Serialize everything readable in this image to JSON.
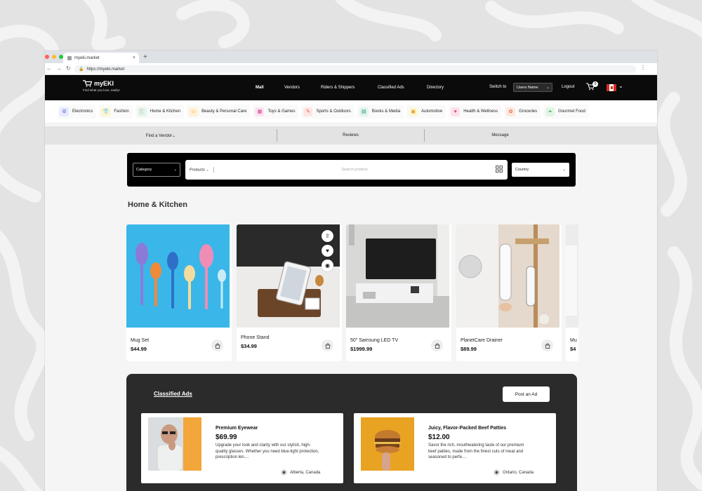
{
  "browser": {
    "tab_title": "myeki.market",
    "tab_close": "×",
    "new_tab": "+",
    "url": "https://myeki.market",
    "back": "←",
    "forward": "→",
    "reload": "↻",
    "menu": "⋮",
    "lock": "🔒"
  },
  "header": {
    "brand": "myEKI",
    "tagline": "Find what you love, easily!",
    "nav": [
      {
        "label": "Mall"
      },
      {
        "label": "Vendors"
      },
      {
        "label": "Riders & Shippers"
      },
      {
        "label": "Classified Ads"
      },
      {
        "label": "Directory"
      }
    ],
    "switch_to": "Switch to",
    "users_select": "Users Name",
    "logout": "Logout",
    "cart_count": "0",
    "caret": "⌄"
  },
  "categories": [
    {
      "label": "Electronics",
      "icon": "⚙",
      "bg": "#e6e9ff",
      "fg": "#5b5fd6"
    },
    {
      "label": "Fashion",
      "icon": "👕",
      "bg": "#fff4cc",
      "fg": "#d19a00"
    },
    {
      "label": "Home & Kitchen",
      "icon": "🍴",
      "bg": "#e3f5e9",
      "fg": "#2e9c57"
    },
    {
      "label": "Beauty & Personal Care",
      "icon": "☺",
      "bg": "#fff1d6",
      "fg": "#e09a1a"
    },
    {
      "label": "Toys & Games",
      "icon": "▦",
      "bg": "#fde3ef",
      "fg": "#d63b86"
    },
    {
      "label": "Sports & Outdoors",
      "icon": "✎",
      "bg": "#ffe5e1",
      "fg": "#e35a3f"
    },
    {
      "label": "Books & Media",
      "icon": "▤",
      "bg": "#e0f4ec",
      "fg": "#24966a"
    },
    {
      "label": "Automotive",
      "icon": "▣",
      "bg": "#fff5d9",
      "fg": "#d8a012"
    },
    {
      "label": "Health & Wellness",
      "icon": "♥",
      "bg": "#fde2ea",
      "fg": "#e0416a"
    },
    {
      "label": "Groceries",
      "icon": "✿",
      "bg": "#ffe7e0",
      "fg": "#e06240"
    },
    {
      "label": "Gourmet Food",
      "icon": "❧",
      "bg": "#e2f5e6",
      "fg": "#3aa35a"
    }
  ],
  "subnav": {
    "find_vendor": "Find a Vendor⌄",
    "reviews": "Reviews",
    "message": "Message"
  },
  "search": {
    "category_label": "Category",
    "products_label": "Products",
    "placeholder": "Search product",
    "country_label": "Country",
    "chevron": "⌄"
  },
  "section_title": "Home & Kitchen",
  "products": [
    {
      "name": "Mug Set",
      "price": "$44.99"
    },
    {
      "name": "Phone Stand",
      "price": "$34.99"
    },
    {
      "name": "50\" Samsung LED TV",
      "price": "$1999.99"
    },
    {
      "name": "PlanetCare Drainer",
      "price": "$89.99"
    },
    {
      "name": "Mu",
      "price": "$4"
    }
  ],
  "product_actions": {
    "share": "⇪",
    "like": "♥",
    "view": "◉"
  },
  "classified": {
    "title": "Classified Ads",
    "post_button": "Post an Ad",
    "ads": [
      {
        "title": "Premium Eyewear",
        "price": "$69.99",
        "desc": "Upgrade your look and clarity with our stylish, high-quality glasses. Whether you need blue-light protection, prescription len....",
        "location": "Alberta, Canada"
      },
      {
        "title": "Juicy, Flavor-Packed Beef Patties",
        "price": "$12.00",
        "desc": "Savor the rich, mouthwatering taste of our premium beef patties, made from the finest cuts of meat and seasoned to perfe....",
        "location": "Ontario, Canada"
      }
    ]
  },
  "colors": {
    "header_bg": "#0b0b0b",
    "accent": "#000000",
    "canvas_bg": "#f5f5f5"
  }
}
